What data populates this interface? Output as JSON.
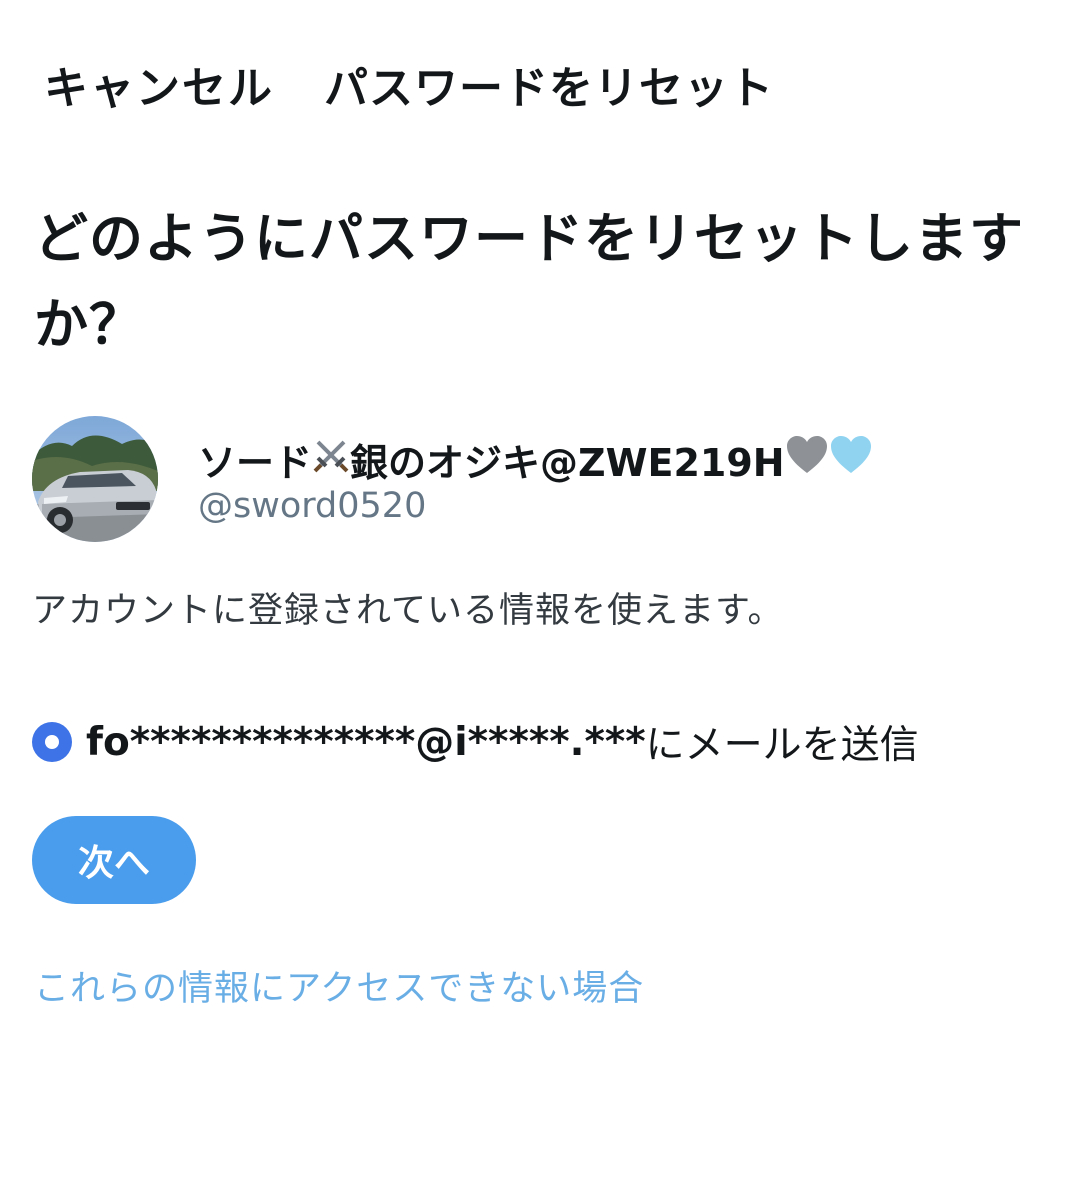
{
  "header": {
    "cancel_label": "キャンセル",
    "title": "パスワードをリセット"
  },
  "main": {
    "heading": "どのようにパスワードをリセットしますか？",
    "account": {
      "display_name_start": "ソード",
      "display_name_middle": "銀のオジキ@ZWE219H",
      "name_icons": [
        "crossed-swords-icon",
        "grey-heart-icon",
        "light-blue-heart-icon"
      ],
      "handle": "@sword0520"
    },
    "info_text": "アカウントに登録されている情報を使えます。",
    "option": {
      "email_masked": "fo**************@i*****.***",
      "suffix": "にメールを送信",
      "selected": true
    },
    "next_button_label": "次へ",
    "alt_link": "これらの情報にアクセスできない場合"
  },
  "colors": {
    "accent": "#4a9dec",
    "radio": "#3d73e6",
    "link": "#6aaee6",
    "secondary_text": "#657786"
  }
}
